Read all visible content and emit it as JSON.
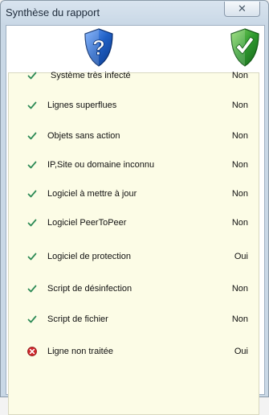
{
  "window": {
    "title": "Synthèse du rapport",
    "close_glyph": "✕"
  },
  "header": {
    "left_icon": "question-shield-icon",
    "right_icon": "check-shield-icon",
    "colors": {
      "blue_shield": "#1f5fc4",
      "green_shield": "#2f9a2f",
      "panel_bg": "#fcfce6",
      "check": "#2e8b57",
      "error": "#d0262a"
    }
  },
  "rows": [
    {
      "label": "Système très infecté",
      "value": "Non",
      "status": "ok"
    },
    {
      "label": "Lignes superflues",
      "value": "Non",
      "status": "ok"
    },
    {
      "label": "Objets sans action",
      "value": "Non",
      "status": "ok"
    },
    {
      "label": "IP,Site ou domaine inconnu",
      "value": "Non",
      "status": "ok"
    },
    {
      "label": "Logiciel à mettre à jour",
      "value": "Non",
      "status": "ok"
    },
    {
      "label": "Logiciel PeerToPeer",
      "value": "Non",
      "status": "ok"
    },
    {
      "label": "Logiciel de protection",
      "value": "Oui",
      "status": "ok"
    },
    {
      "label": "Script de désinfection",
      "value": "Non",
      "status": "ok"
    },
    {
      "label": "Script de fichier",
      "value": "Non",
      "status": "ok"
    },
    {
      "label": "Ligne non traitée",
      "value": "Oui",
      "status": "error"
    }
  ]
}
